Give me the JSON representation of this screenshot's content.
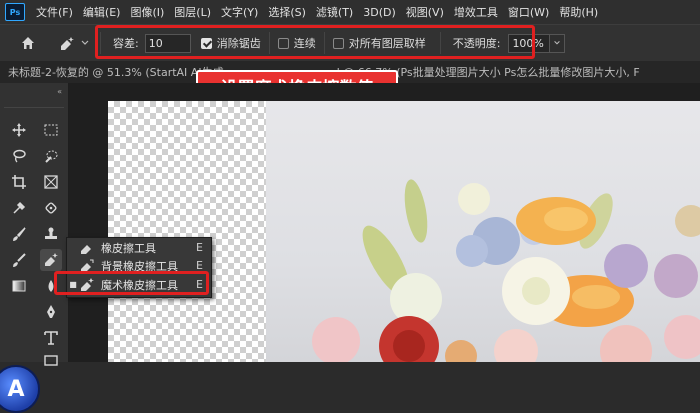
{
  "app": {
    "logo": "Ps"
  },
  "menu": [
    "文件(F)",
    "编辑(E)",
    "图像(I)",
    "图层(L)",
    "文字(Y)",
    "选择(S)",
    "滤镜(T)",
    "3D(D)",
    "视图(V)",
    "增效工具",
    "窗口(W)",
    "帮助(H)"
  ],
  "options": {
    "tolerance_label": "容差:",
    "tolerance_value": "10",
    "antialias_label": "消除锯齿",
    "antialias_checked": true,
    "contiguous_label": "连续",
    "contiguous_checked": false,
    "sample_all_label": "对所有图层取样",
    "sample_all_checked": false,
    "opacity_label": "不透明度:",
    "opacity_value": "100%"
  },
  "tabs": [
    "未标题-2-恢复的 @ 51.3% (StartAI AI生成",
    "...psd @ 66.7% (Ps批量处理图片大小 Ps怎么批量修改图片大小, F"
  ],
  "callout": "设置魔术橡皮擦数值",
  "toolbar": {
    "collapse": "«"
  },
  "flyout": {
    "items": [
      {
        "label": "橡皮擦工具",
        "key": "E",
        "icon": "eraser-icon",
        "active": false
      },
      {
        "label": "背景橡皮擦工具",
        "key": "E",
        "icon": "background-eraser-icon",
        "active": false
      },
      {
        "label": "魔术橡皮擦工具",
        "key": "E",
        "icon": "magic-eraser-icon",
        "active": true
      }
    ]
  },
  "colors": {
    "highlight_red": "#e02020",
    "callout_red": "#e93230",
    "ui_dark": "#323232"
  }
}
